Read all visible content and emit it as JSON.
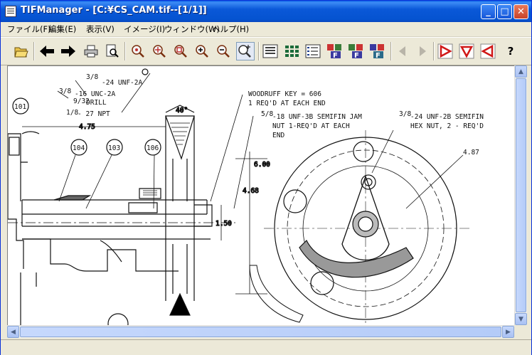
{
  "window": {
    "title": "TIFManager - [C:¥CS_CAM.tif--[1/1]]",
    "buttons": {
      "minimize": "_",
      "maximize": "□",
      "close": "✕"
    }
  },
  "menu": [
    "ファイル(F)",
    "編集(E)",
    "表示(V)",
    "イメージ(I)",
    "ウィンドウ(W)",
    "ヘルプ(H)"
  ],
  "toolbar": {
    "help_glyph": "?"
  },
  "status": {
    "text": ""
  },
  "drawing": {
    "labels": {
      "t1_frac": "3/8",
      "t1": "-24 UNF-2A",
      "t2_frac": "3/8",
      "t2": "-16 UNC-2A",
      "t3_frac": "9/32",
      "t3": "DRILL",
      "t4_frac": "1/8",
      "t4": "- 27 NPT",
      "woodruff1": "WOODRUFF KEY = 606",
      "woodruff2": "1 REQ'D AT EACH END",
      "nut_frac": "5/8",
      "nut1": "-18 UNF-3B SEMIFIN JAM",
      "nut2": "NUT 1-REQ'D AT EACH",
      "nut3": "END",
      "hex_frac": "3/8",
      "hex1": "-24 UNF-2B SEMIFIN",
      "hex2": "HEX NUT, 2 - REQ'D",
      "dim_475": "4.75",
      "dim_40": "40°",
      "dim_600": "6.00",
      "dim_468": "4.68",
      "dim_150": "1.50",
      "dim_487": "4.87",
      "balloon_101": "101",
      "balloon_104": "104",
      "balloon_103": "103",
      "balloon_106": "106"
    }
  }
}
